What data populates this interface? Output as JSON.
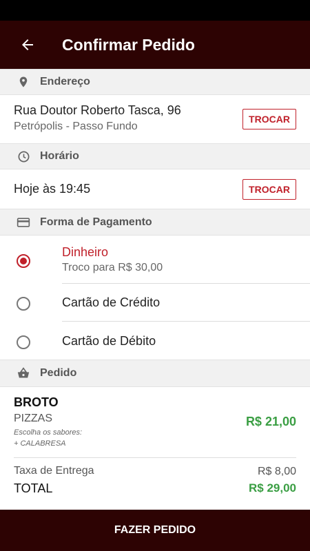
{
  "appbar": {
    "title": "Confirmar Pedido",
    "back_icon": "arrow-left-icon"
  },
  "address": {
    "header": "Endereço",
    "icon": "location-pin-icon",
    "street": "Rua Doutor Roberto Tasca, 96",
    "district": "Petrópolis - Passo Fundo",
    "change_label": "TROCAR"
  },
  "schedule": {
    "header": "Horário",
    "icon": "clock-icon",
    "time": "Hoje às 19:45",
    "change_label": "TROCAR"
  },
  "payment": {
    "header": "Forma de Pagamento",
    "icon": "credit-card-icon",
    "options": [
      {
        "label": "Dinheiro",
        "sub": "Troco para R$ 30,00",
        "selected": true
      },
      {
        "label": "Cartão de Crédito",
        "selected": false
      },
      {
        "label": "Cartão de Débito",
        "selected": false
      }
    ]
  },
  "order": {
    "header": "Pedido",
    "icon": "basket-icon",
    "item_name": "BROTO",
    "item_category": "PIZZAS",
    "item_note1": "Escolha os sabores:",
    "item_note2": "+ CALABRESA",
    "item_price": "R$ 21,00",
    "fee_label": "Taxa de Entrega",
    "fee_value": "R$ 8,00",
    "total_label": "TOTAL",
    "total_value": "R$ 29,00"
  },
  "footer": {
    "submit_label": "FAZER PEDIDO"
  },
  "colors": {
    "brand": "#2d0303",
    "accent": "#c0202a",
    "price": "#3a9e43"
  }
}
